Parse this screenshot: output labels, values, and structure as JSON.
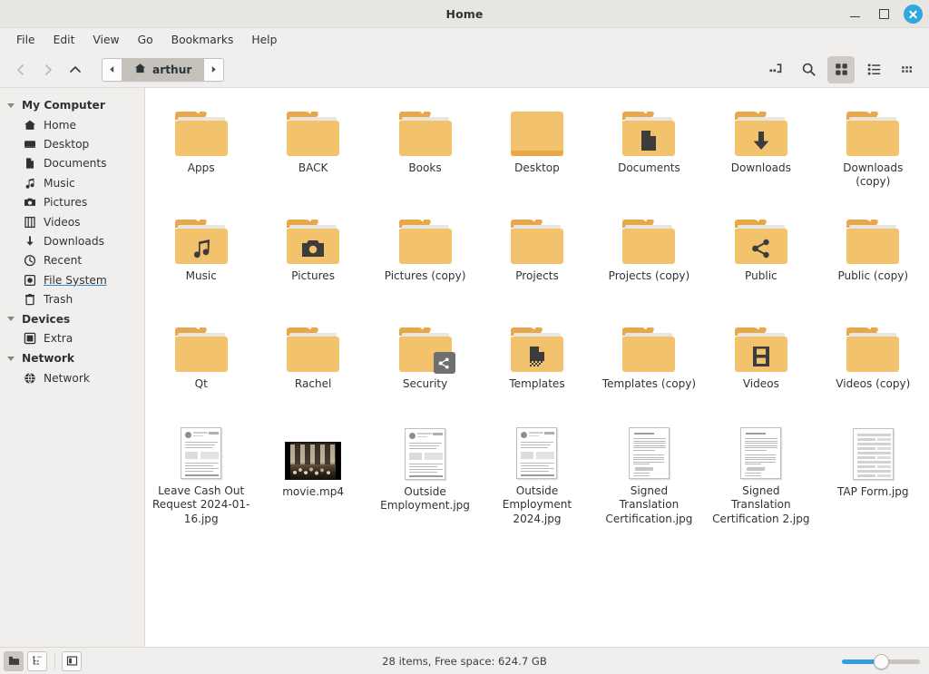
{
  "window": {
    "title": "Home",
    "controls": {
      "minimize": "minimize-window",
      "maximize": "maximize-window",
      "close": "close-window"
    }
  },
  "menubar": {
    "items": [
      {
        "label": "File"
      },
      {
        "label": "Edit"
      },
      {
        "label": "View"
      },
      {
        "label": "Go"
      },
      {
        "label": "Bookmarks"
      },
      {
        "label": "Help"
      }
    ]
  },
  "toolbar": {
    "back": "back-icon",
    "forward": "forward-icon",
    "up": "up-icon",
    "pathbar": {
      "scroll_left": "path-scroll-left-icon",
      "scroll_right": "path-scroll-right-icon",
      "crumb": "arthur",
      "crumb_icon": "home-icon"
    },
    "buttons": [
      {
        "name": "toggle-location-entry",
        "icon": "location-entry-icon",
        "active": false
      },
      {
        "name": "search",
        "icon": "search-icon",
        "active": false
      },
      {
        "name": "icon-view",
        "icon": "grid-view-icon",
        "active": true
      },
      {
        "name": "list-view",
        "icon": "list-view-icon",
        "active": false
      },
      {
        "name": "compact-view",
        "icon": "compact-view-icon",
        "active": false
      }
    ]
  },
  "sidebar": {
    "groups": [
      {
        "label": "My Computer",
        "items": [
          {
            "label": "Home",
            "icon": "home-icon",
            "hovered": false
          },
          {
            "label": "Desktop",
            "icon": "desktop-icon",
            "hovered": false
          },
          {
            "label": "Documents",
            "icon": "document-icon",
            "hovered": false
          },
          {
            "label": "Music",
            "icon": "music-note-icon",
            "hovered": false
          },
          {
            "label": "Pictures",
            "icon": "camera-icon",
            "hovered": false
          },
          {
            "label": "Videos",
            "icon": "film-icon",
            "hovered": false
          },
          {
            "label": "Downloads",
            "icon": "download-arrow-icon",
            "hovered": false
          },
          {
            "label": "Recent",
            "icon": "clock-icon",
            "hovered": false
          },
          {
            "label": "File System",
            "icon": "harddisk-icon",
            "hovered": true
          },
          {
            "label": "Trash",
            "icon": "trash-icon",
            "hovered": false
          }
        ]
      },
      {
        "label": "Devices",
        "items": [
          {
            "label": "Extra",
            "icon": "drive-icon",
            "hovered": false
          }
        ]
      },
      {
        "label": "Network",
        "items": [
          {
            "label": "Network",
            "icon": "globe-icon",
            "hovered": false
          }
        ]
      }
    ]
  },
  "files": {
    "items": [
      {
        "label": "Apps",
        "type": "folder",
        "glyph": "none"
      },
      {
        "label": "BACK",
        "type": "folder",
        "glyph": "none"
      },
      {
        "label": "Books",
        "type": "folder",
        "glyph": "none"
      },
      {
        "label": "Desktop",
        "type": "folder-solid",
        "glyph": "none"
      },
      {
        "label": "Documents",
        "type": "folder",
        "glyph": "document"
      },
      {
        "label": "Downloads",
        "type": "folder",
        "glyph": "download"
      },
      {
        "label": "Downloads (copy)",
        "type": "folder",
        "glyph": "none"
      },
      {
        "label": "Music",
        "type": "folder",
        "glyph": "music"
      },
      {
        "label": "Pictures",
        "type": "folder",
        "glyph": "camera"
      },
      {
        "label": "Pictures (copy)",
        "type": "folder",
        "glyph": "none"
      },
      {
        "label": "Projects",
        "type": "folder",
        "glyph": "none"
      },
      {
        "label": "Projects (copy)",
        "type": "folder",
        "glyph": "none"
      },
      {
        "label": "Public",
        "type": "folder",
        "glyph": "share"
      },
      {
        "label": "Public (copy)",
        "type": "folder",
        "glyph": "none"
      },
      {
        "label": "Qt",
        "type": "folder",
        "glyph": "none"
      },
      {
        "label": "Rachel",
        "type": "folder",
        "glyph": "none"
      },
      {
        "label": "Security",
        "type": "folder",
        "glyph": "none",
        "emblem": "shared"
      },
      {
        "label": "Templates",
        "type": "folder",
        "glyph": "template"
      },
      {
        "label": "Templates (copy)",
        "type": "folder",
        "glyph": "none"
      },
      {
        "label": "Videos",
        "type": "folder",
        "glyph": "film"
      },
      {
        "label": "Videos (copy)",
        "type": "folder",
        "glyph": "none"
      },
      {
        "label": "Leave Cash Out Request 2024-01-16.jpg",
        "type": "image-doc",
        "variant": "form"
      },
      {
        "label": "movie.mp4",
        "type": "video"
      },
      {
        "label": "Outside Employment.jpg",
        "type": "image-doc",
        "variant": "form"
      },
      {
        "label": "Outside Employment 2024.jpg",
        "type": "image-doc",
        "variant": "form"
      },
      {
        "label": "Signed Translation Certification.jpg",
        "type": "image-doc",
        "variant": "letter"
      },
      {
        "label": "Signed Translation Certification 2.jpg",
        "type": "image-doc",
        "variant": "letter"
      },
      {
        "label": "TAP Form.jpg",
        "type": "image-doc",
        "variant": "table"
      }
    ]
  },
  "statusbar": {
    "text": "28 items, Free space: 624.7 GB",
    "buttons": [
      {
        "name": "icon-view-toggle",
        "icon": "folder-view-icon",
        "active": true
      },
      {
        "name": "tree-view-toggle",
        "icon": "tree-view-icon",
        "active": false
      },
      {
        "name": "show-sidebar-toggle",
        "icon": "sidebar-icon",
        "active": false
      }
    ],
    "zoom": {
      "value": 50
    }
  },
  "colors": {
    "accent": "#2e9fe0",
    "folder": "#f3c26c",
    "folder_dark": "#e8a849",
    "chrome": "#f0efee",
    "titlebar": "#e8e6e3"
  }
}
